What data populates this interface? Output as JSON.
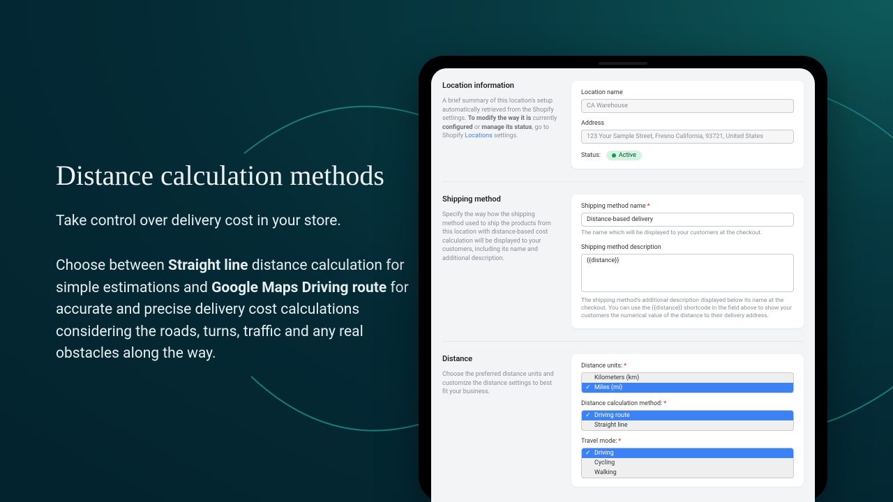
{
  "hero": {
    "title": "Distance calculation methods",
    "tagline": "Take control over delivery cost in your store.",
    "body_pre": "Choose between ",
    "bold1": "Straight line",
    "body_mid": " distance calculation for simple estimations and ",
    "bold2": "Google Maps Driving route",
    "body_post": " for accurate and precise delivery cost calculations considering the roads, turns, traffic and any real obstacles along the way."
  },
  "loc": {
    "heading": "Location information",
    "desc_pre": "A brief summary of this location's setup automatically retrieved from the Shopify settings. ",
    "desc_b1": "To modify the way it is",
    "desc_mid1": " currently ",
    "desc_b2": "configured",
    "desc_mid2": " or ",
    "desc_b3": "manage its status",
    "desc_mid3": ", go to Shopify ",
    "desc_link": "Locations",
    "desc_post": " settings.",
    "name_label": "Location name",
    "name_value": "CA Warehouse",
    "addr_label": "Address",
    "addr_value": "123 Your Sample Street, Fresno California, 93721, United States",
    "status_label": "Status:",
    "status_value": "Active"
  },
  "ship": {
    "heading": "Shipping method",
    "desc": "Specify the way how the shipping method used to ship the products from this location with distance-based cost calculation will be displayed to your customers, including its name and additional description.",
    "name_label": "Shipping method name",
    "name_value": "Distance-based delivery",
    "name_help": "The name which will be displayed to your customers at the checkout.",
    "desc_label": "Shipping method description",
    "desc_value": "{{distance}}",
    "desc_help": "The shipping method's additional description displayed below its name at the checkout. You can use the {{distance}} shortcode in the field above to show your customers the numerical value of the distance to their delivery address."
  },
  "dist": {
    "heading": "Distance",
    "desc": "Choose the preferred distance units and customize the distance settings to best fit your business.",
    "units_label": "Distance units:",
    "units": [
      "Kilometers (km)",
      "Miles (mi)"
    ],
    "method_label": "Distance calculation method:",
    "methods": [
      "Driving route",
      "Straight line"
    ],
    "mode_label": "Travel mode:",
    "modes": [
      "Driving",
      "Cycling",
      "Walking"
    ]
  }
}
